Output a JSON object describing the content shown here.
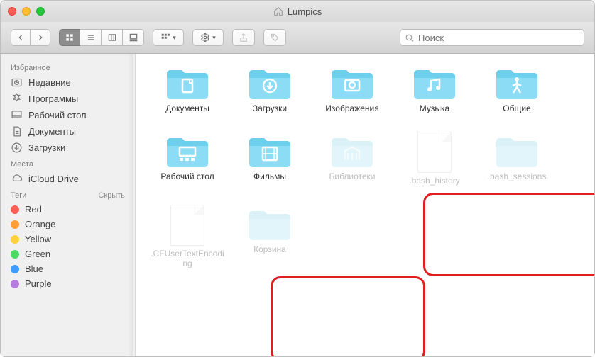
{
  "window": {
    "title": "Lumpics"
  },
  "toolbar": {
    "search_placeholder": "Поиск"
  },
  "sidebar": {
    "sections": [
      {
        "header": "Избранное",
        "items": [
          {
            "label": "Недавние",
            "icon": "clock"
          },
          {
            "label": "Программы",
            "icon": "apps"
          },
          {
            "label": "Рабочий стол",
            "icon": "desktop"
          },
          {
            "label": "Документы",
            "icon": "document"
          },
          {
            "label": "Загрузки",
            "icon": "download"
          }
        ]
      },
      {
        "header": "Места",
        "items": [
          {
            "label": "iCloud Drive",
            "icon": "cloud"
          }
        ]
      },
      {
        "header": "Теги",
        "hide_label": "Скрыть",
        "items": [
          {
            "label": "Red",
            "color": "#ff5d55"
          },
          {
            "label": "Orange",
            "color": "#ff9d36"
          },
          {
            "label": "Yellow",
            "color": "#ffd23a"
          },
          {
            "label": "Green",
            "color": "#4cd964"
          },
          {
            "label": "Blue",
            "color": "#3e9bff"
          },
          {
            "label": "Purple",
            "color": "#b57edc"
          }
        ]
      }
    ]
  },
  "items": [
    {
      "label": "Документы",
      "kind": "folder",
      "glyph": "doc",
      "ghost": false
    },
    {
      "label": "Загрузки",
      "kind": "folder",
      "glyph": "download",
      "ghost": false
    },
    {
      "label": "Изображения",
      "kind": "folder",
      "glyph": "photo",
      "ghost": false
    },
    {
      "label": "Музыка",
      "kind": "folder",
      "glyph": "music",
      "ghost": false
    },
    {
      "label": "Общие",
      "kind": "folder",
      "glyph": "walker",
      "ghost": false
    },
    {
      "label": "Рабочий стол",
      "kind": "folder",
      "glyph": "gallery",
      "ghost": false
    },
    {
      "label": "Фильмы",
      "kind": "folder",
      "glyph": "film",
      "ghost": false
    },
    {
      "label": "Библиотеки",
      "kind": "folder",
      "glyph": "library",
      "ghost": true
    },
    {
      "label": ".bash_history",
      "kind": "file",
      "glyph": "",
      "ghost": true
    },
    {
      "label": ".bash_sessions",
      "kind": "folder",
      "glyph": "plain",
      "ghost": true
    },
    {
      "label": ".CFUserTextEncoding",
      "kind": "file",
      "glyph": "",
      "ghost": true
    },
    {
      "label": "Корзина",
      "kind": "folder",
      "glyph": "plain",
      "ghost": true
    }
  ]
}
